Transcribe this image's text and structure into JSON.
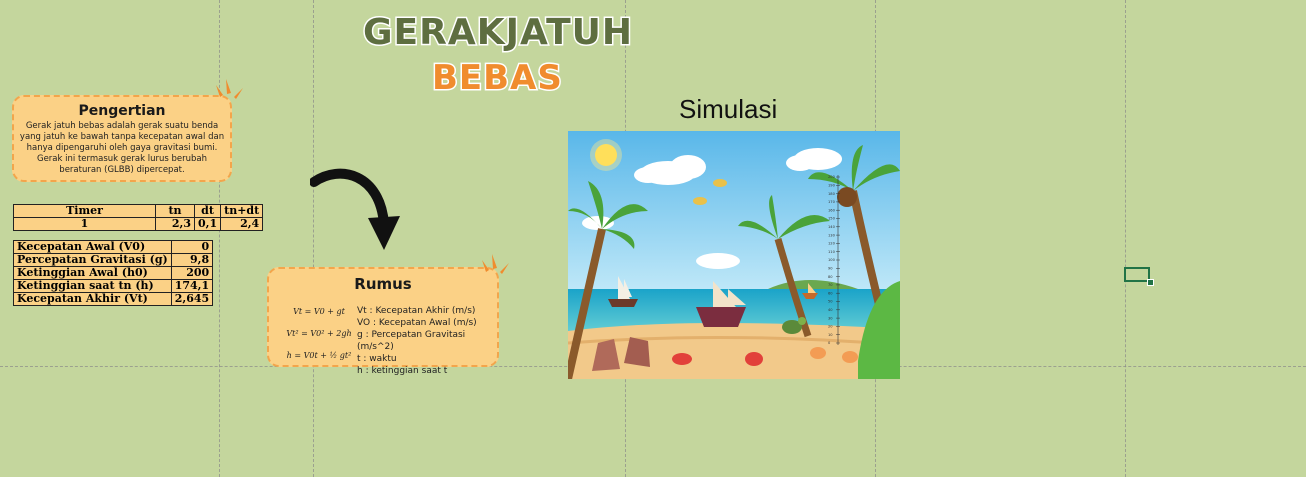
{
  "title": {
    "line1": "GERAKJATUH",
    "line2": "BEBAS"
  },
  "definition": {
    "heading": "Pengertian",
    "text": "Gerak jatuh bebas adalah gerak suatu benda yang jatuh ke bawah tanpa kecepatan awal dan hanya dipengaruhi oleh gaya gravitasi bumi. Gerak ini termasuk gerak lurus berubah beraturan (GLBB) dipercepat."
  },
  "timer_table": {
    "headers": [
      "Timer",
      "tn",
      "dt",
      "tn+dt"
    ],
    "values": [
      "1",
      "2,3",
      "0,1",
      "2,4"
    ]
  },
  "params": [
    {
      "label": "Kecepatan Awal (V0)",
      "value": "0"
    },
    {
      "label": "Percepatan Gravitasi (g)",
      "value": "9,8"
    },
    {
      "label": "Ketinggian Awal (h0)",
      "value": "200"
    },
    {
      "label": "Ketinggian saat tn (h)",
      "value": "174,1"
    },
    {
      "label": "Kecepatan Akhir (Vt)",
      "value": "2,645"
    }
  ],
  "rumus": {
    "heading": "Rumus",
    "formulas": [
      "Vt = V0 + gt",
      "Vt² = V0² + 2gh",
      "h = V0t + ½ gt²"
    ],
    "legend": [
      "Vt : Kecepatan Akhir (m/s)",
      "VO : Kecepatan Awal (m/s)",
      "g : Percepatan Gravitasi (m/s^2)",
      "t : waktu",
      "h : ketinggian saat t"
    ]
  },
  "simulation": {
    "label": "Simulasi",
    "scale_ticks": [
      "200",
      "190",
      "180",
      "170",
      "160",
      "150",
      "140",
      "130",
      "120",
      "110",
      "100",
      "90",
      "80",
      "70",
      "60",
      "50",
      "40",
      "30",
      "20",
      "10",
      "0"
    ],
    "coconut_height": 174.1
  },
  "colors": {
    "background": "#c4d69d",
    "card": "#fbd186",
    "card_border": "#f3a54b",
    "title_green": "#5e6e40",
    "title_orange": "#f08c2e",
    "selection": "#217346"
  },
  "icons": {
    "arrow": "curved-down-arrow-icon",
    "spark": "orange-spark-icon"
  }
}
